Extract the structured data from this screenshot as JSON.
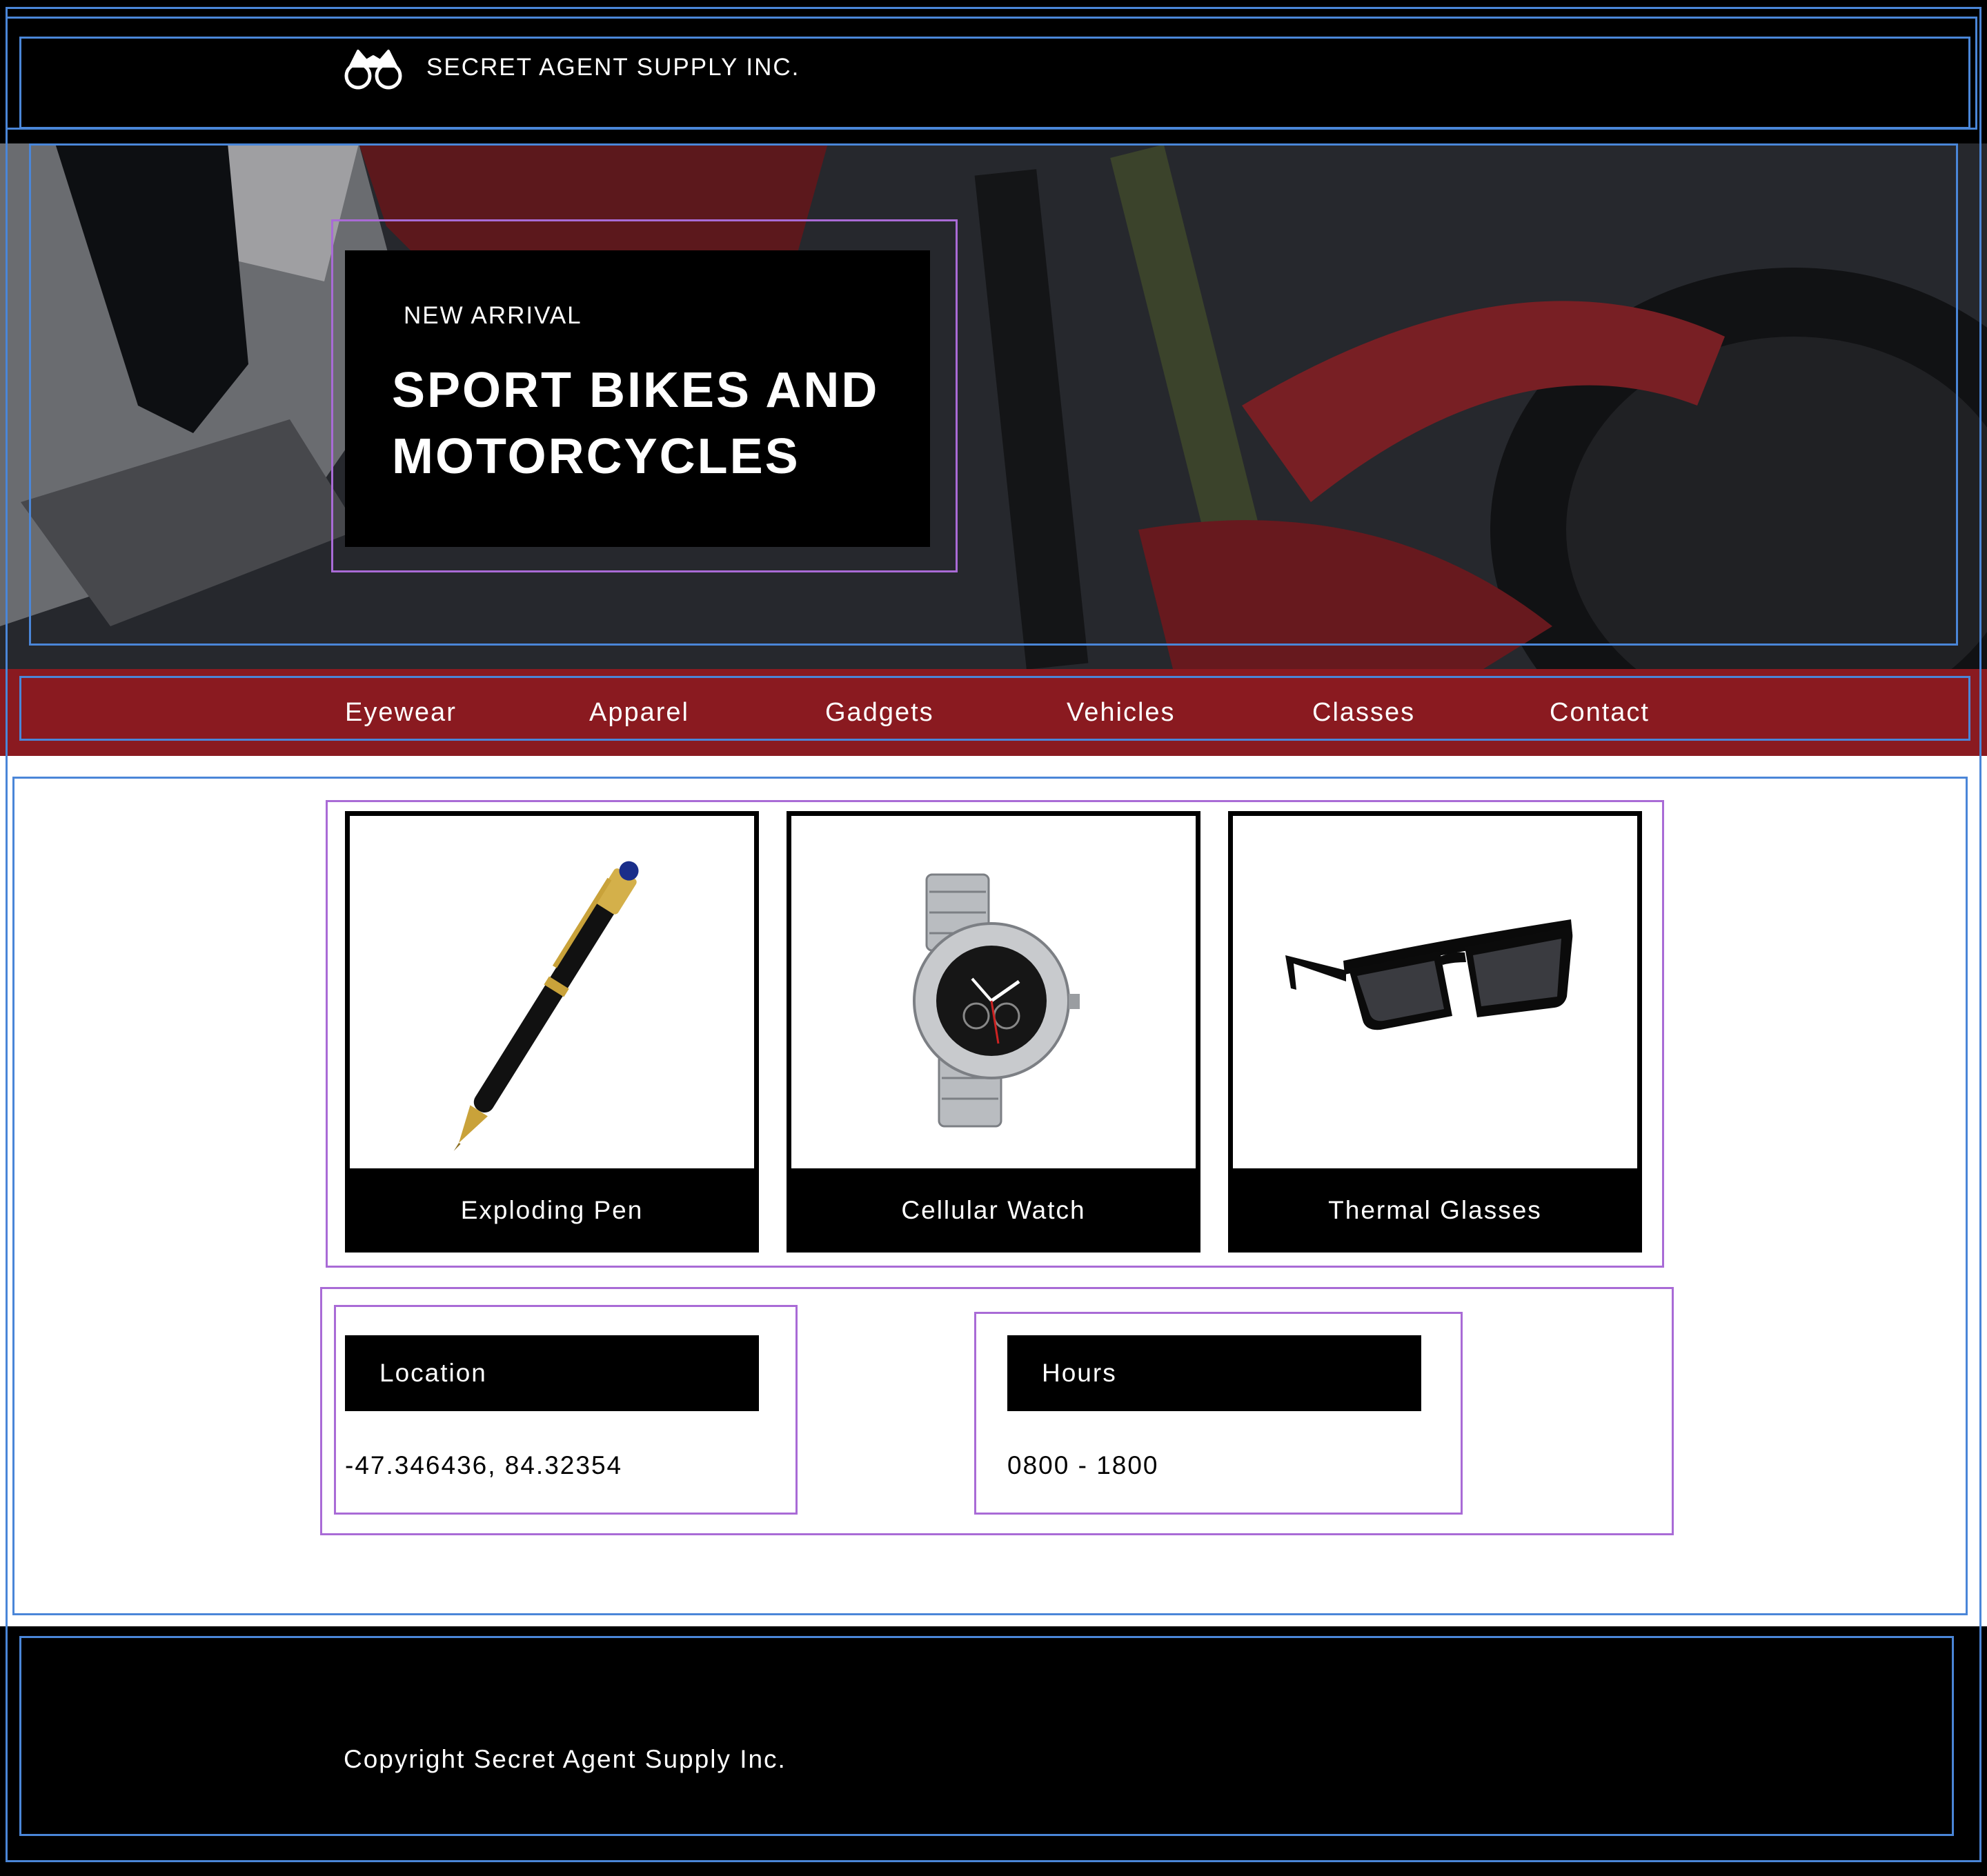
{
  "header": {
    "title": "SECRET AGENT SUPPLY INC.",
    "logo_icon": "binoculars-icon"
  },
  "hero": {
    "kicker": "NEW ARRIVAL",
    "title": "SPORT BIKES AND MOTORCYCLES",
    "background_icon": "motorcycle-photo"
  },
  "nav": {
    "items": [
      "Eyewear",
      "Apparel",
      "Gadgets",
      "Vehicles",
      "Classes",
      "Contact"
    ],
    "background_color": "#8a1a20"
  },
  "products": [
    {
      "name": "Exploding Pen",
      "icon": "pen-image"
    },
    {
      "name": "Cellular Watch",
      "icon": "watch-image"
    },
    {
      "name": "Thermal Glasses",
      "icon": "sunglasses-image"
    }
  ],
  "info": {
    "location": {
      "heading": "Location",
      "value": "-47.346436, 84.32354"
    },
    "hours": {
      "heading": "Hours",
      "value": "0800 - 1800"
    }
  },
  "footer": {
    "copyright": "Copyright Secret Agent Supply Inc."
  }
}
